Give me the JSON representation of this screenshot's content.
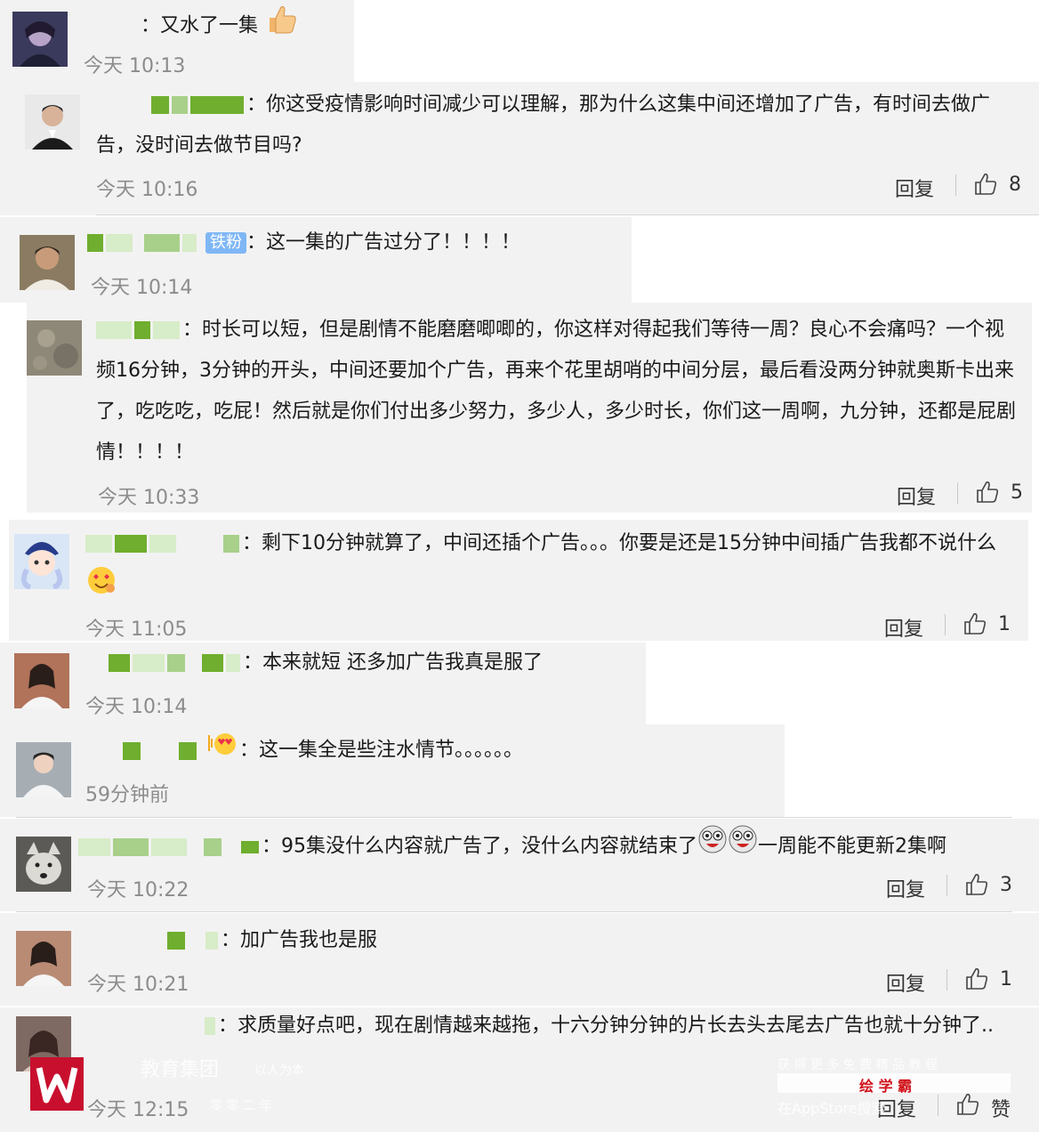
{
  "comments": [
    {
      "text": "：又水了一集",
      "time": "今天 10:13"
    },
    {
      "text": "：你这受疫情影响时间减少可以理解，那为什么这集中间还增加了广告，有时间去做广告，没时间去做节目吗?",
      "time": "今天 10:16",
      "reply": "回复",
      "likes": "8"
    },
    {
      "badge": "铁粉",
      "text": "：这一集的广告过分了！！！！",
      "time": "今天 10:14"
    },
    {
      "text": "：时长可以短，但是剧情不能磨磨唧唧的，你这样对得起我们等待一周？良心不会痛吗？一个视频16分钟，3分钟的开头，中间还要加个广告，再来个花里胡哨的中间分层，最后看没两分钟就奥斯卡出来了，吃吃吃，吃屁！然后就是你们付出多少努力，多少人，多少时长，你们这一周啊，九分钟，还都是屁剧情！！！！",
      "time": "今天 10:33",
      "reply": "回复",
      "likes": "5"
    },
    {
      "text": "：剩下10分钟就算了，中间还插个广告。。。你要是还是15分钟中间插广告我都不说什么",
      "time": "今天 11:05",
      "reply": "回复",
      "likes": "1"
    },
    {
      "text": "：本来就短 还多加广告我真是服了",
      "time": "今天 10:14"
    },
    {
      "text": "：这一集全是些注水情节。。。。。。",
      "time": "59分钟前"
    },
    {
      "text_a": "：95集没什么内容就广告了，没什么内容就结束了",
      "text_b": "一周能不能更新2集啊",
      "time": "今天 10:22",
      "reply": "回复",
      "likes": "3"
    },
    {
      "text": "：加广告我也是服",
      "time": "今天 10:21",
      "reply": "回复",
      "likes": "1"
    },
    {
      "text": "：求质量好点吧，现在剧情越来越拖，十六分钟分钟的片长去头去尾去广告也就十分钟了..",
      "time": "今天 12:15",
      "reply": "回复",
      "likes": "赞"
    }
  ],
  "watermark": {
    "left_title": "教育集团",
    "left_slogan": "以人为本",
    "left_sub": "零 零 二 年",
    "right_top": "获 得 更 多 免 费 精 品 教 程",
    "right_brand": "绘 学 霸",
    "right_bottom": "在AppStore搜索"
  },
  "colors": {
    "accent_green": "#6fae2e",
    "badge_blue": "#7fb7f5",
    "logo_red": "#c8102e"
  }
}
